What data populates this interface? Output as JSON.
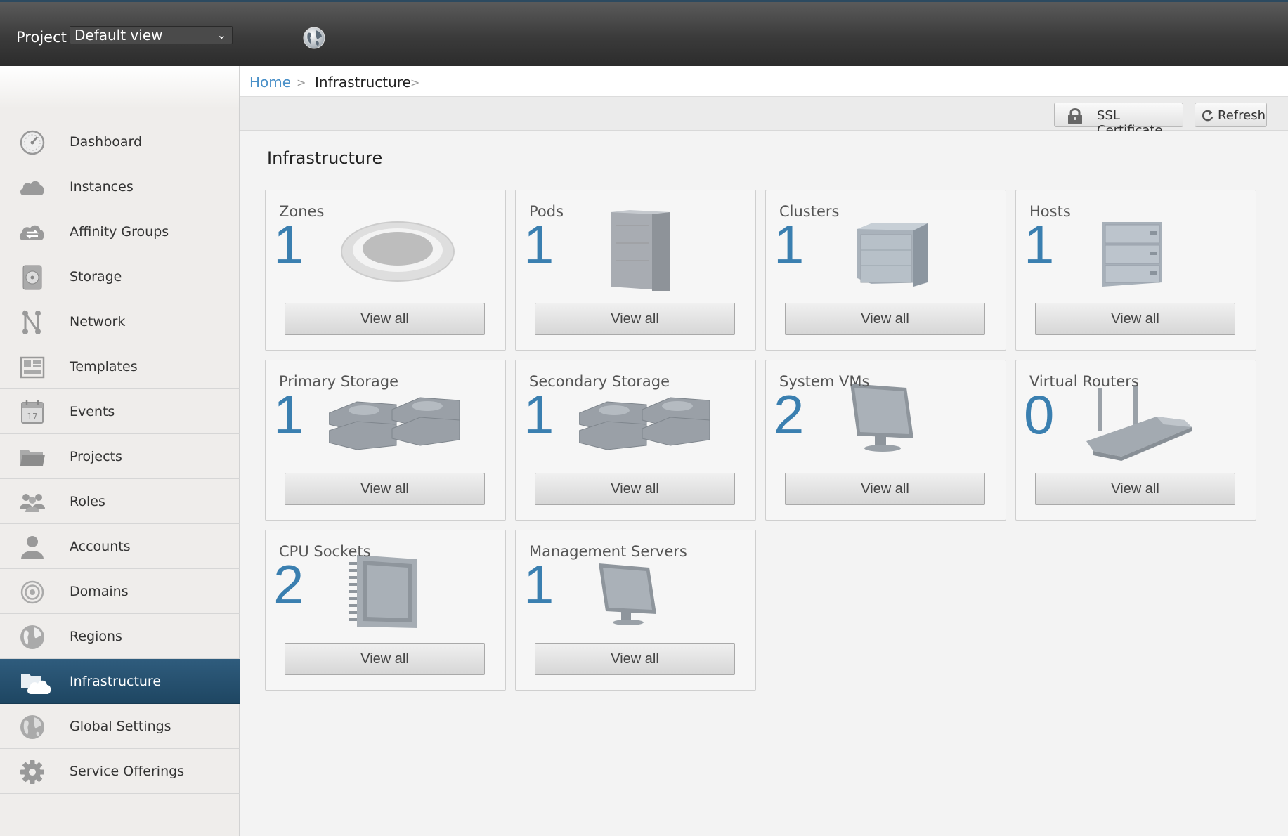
{
  "header": {
    "project_label": "Project",
    "project_select": "Default view",
    "globe_icon": "globe-icon"
  },
  "sidebar": {
    "items": [
      {
        "label": "Dashboard",
        "icon": "dashboard-icon"
      },
      {
        "label": "Instances",
        "icon": "cloud-icon"
      },
      {
        "label": "Affinity Groups",
        "icon": "affinity-icon"
      },
      {
        "label": "Storage",
        "icon": "disk-icon"
      },
      {
        "label": "Network",
        "icon": "network-icon"
      },
      {
        "label": "Templates",
        "icon": "templates-icon"
      },
      {
        "label": "Events",
        "icon": "calendar-icon"
      },
      {
        "label": "Projects",
        "icon": "folder-icon"
      },
      {
        "label": "Roles",
        "icon": "roles-icon"
      },
      {
        "label": "Accounts",
        "icon": "user-icon"
      },
      {
        "label": "Domains",
        "icon": "domains-icon"
      },
      {
        "label": "Regions",
        "icon": "globe-icon"
      },
      {
        "label": "Infrastructure",
        "icon": "infrastructure-icon",
        "active": true
      },
      {
        "label": "Global Settings",
        "icon": "globe-settings-icon"
      },
      {
        "label": "Service Offerings",
        "icon": "gear-icon"
      }
    ],
    "active_color": "#2a5675"
  },
  "breadcrumb": {
    "home": "Home",
    "separator": ">",
    "current": "Infrastructure"
  },
  "toolbar": {
    "ssl_label": "SSL Certificate",
    "refresh_label": "Refresh"
  },
  "main": {
    "title": "Infrastructure",
    "tiles": [
      {
        "title": "Zones",
        "count": "1",
        "button": "View all",
        "icon": "zone-icon"
      },
      {
        "title": "Pods",
        "count": "1",
        "button": "View all",
        "icon": "pod-icon"
      },
      {
        "title": "Clusters",
        "count": "1",
        "button": "View all",
        "icon": "cluster-icon"
      },
      {
        "title": "Hosts",
        "count": "1",
        "button": "View all",
        "icon": "host-icon"
      },
      {
        "title": "Primary Storage",
        "count": "1",
        "button": "View all",
        "icon": "primary-storage-icon"
      },
      {
        "title": "Secondary Storage",
        "count": "1",
        "button": "View all",
        "icon": "secondary-storage-icon"
      },
      {
        "title": "System VMs",
        "count": "2",
        "button": "View all",
        "icon": "monitor-icon"
      },
      {
        "title": "Virtual Routers",
        "count": "0",
        "button": "View all",
        "icon": "router-icon"
      },
      {
        "title": "CPU Sockets",
        "count": "2",
        "button": "View all",
        "icon": "cpu-icon"
      },
      {
        "title": "Management Servers",
        "count": "1",
        "button": "View all",
        "icon": "monitor-icon"
      }
    ],
    "count_color": "#3a7fb0"
  }
}
